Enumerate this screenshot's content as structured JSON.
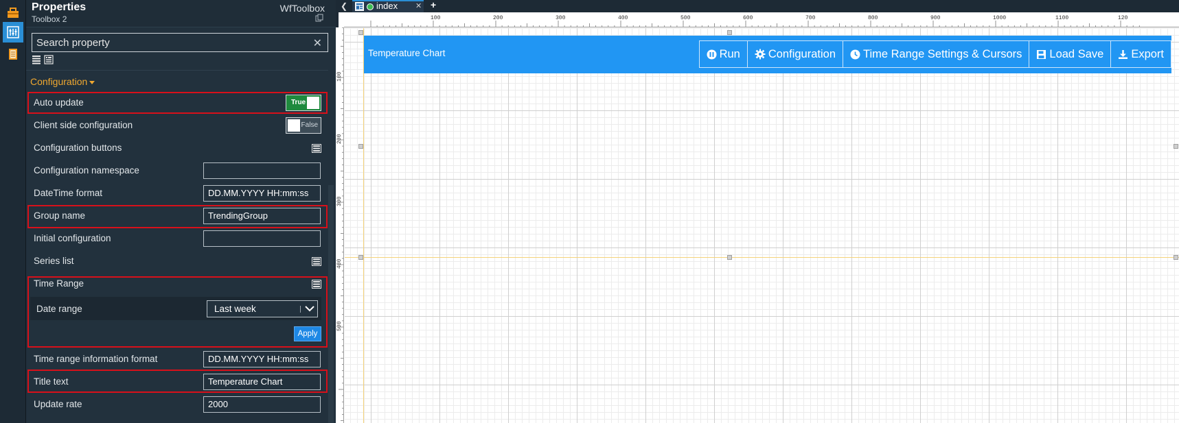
{
  "properties_panel": {
    "title": "Properties",
    "subtitle": "Toolbox 2",
    "component_type": "WfToolbox",
    "search": {
      "placeholder": "Search property",
      "value": ""
    },
    "section_label": "Configuration",
    "rows": {
      "auto_update": {
        "label": "Auto update",
        "toggle": "True"
      },
      "client_side_configuration": {
        "label": "Client side configuration",
        "toggle": "False"
      },
      "configuration_buttons": {
        "label": "Configuration buttons"
      },
      "configuration_namespace": {
        "label": "Configuration namespace",
        "value": ""
      },
      "datetime_format": {
        "label": "DateTime format",
        "value": "DD.MM.YYYY HH:mm:ss"
      },
      "group_name": {
        "label": "Group name",
        "value": "TrendingGroup"
      },
      "initial_configuration": {
        "label": "Initial configuration",
        "value": ""
      },
      "series_list": {
        "label": "Series list"
      },
      "time_range": {
        "label": "Time Range",
        "date_range_label": "Date range",
        "date_range_value": "Last week",
        "apply_label": "Apply"
      },
      "time_range_info_format": {
        "label": "Time range information format",
        "value": "DD.MM.YYYY HH:mm:ss"
      },
      "title_text": {
        "label": "Title text",
        "value": "Temperature Chart"
      },
      "update_rate": {
        "label": "Update rate",
        "value": "2000"
      }
    }
  },
  "editor": {
    "tab_name": "index",
    "ruler_top_labels": [
      "100",
      "200",
      "300",
      "400",
      "500",
      "600",
      "700",
      "800",
      "900",
      "1000",
      "1100",
      "120"
    ],
    "ruler_left_labels": [
      "100",
      "200",
      "300",
      "400",
      "500"
    ],
    "widget": {
      "title": "Temperature Chart",
      "buttons": {
        "run": "Run",
        "configuration": "Configuration",
        "time_range": "Time Range Settings & Cursors",
        "load_save": "Load Save",
        "export": "Export"
      }
    }
  },
  "colors": {
    "accent": "#2196f3",
    "toggle_on": "#1f8a3e",
    "highlight": "#d9101a",
    "section": "#f0a830"
  }
}
